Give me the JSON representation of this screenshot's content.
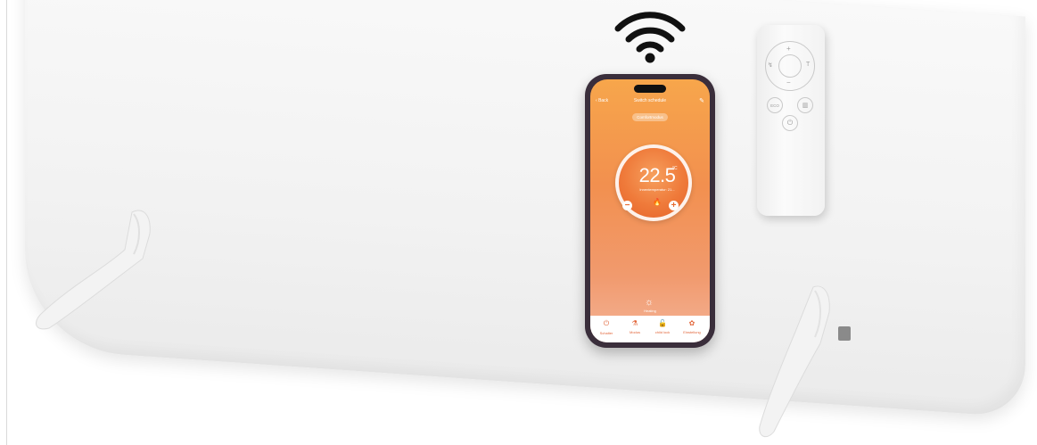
{
  "phone_app": {
    "back_label": "Back",
    "title": "Switch schedule",
    "mode": "Comfortmodus",
    "temperature": "22.5",
    "unit": "°C",
    "sub_label": "Innentemperatur: 21...",
    "status_label": "Heating",
    "tabs": [
      {
        "icon": "⏻",
        "label": "Schalter"
      },
      {
        "icon": "⚗",
        "label": "Modus"
      },
      {
        "icon": "🔓",
        "label": "child lock"
      },
      {
        "icon": "✿",
        "label": "Einstellung"
      }
    ]
  },
  "remote": {
    "plus": "+",
    "minus": "−",
    "left": "↯",
    "right": "T",
    "eco": "ECO",
    "timer": "▥",
    "power": "⏻"
  },
  "colors": {
    "accent": "#f2904f",
    "heater": "#f4f4f4",
    "phone_frame": "#3a2e3b"
  }
}
